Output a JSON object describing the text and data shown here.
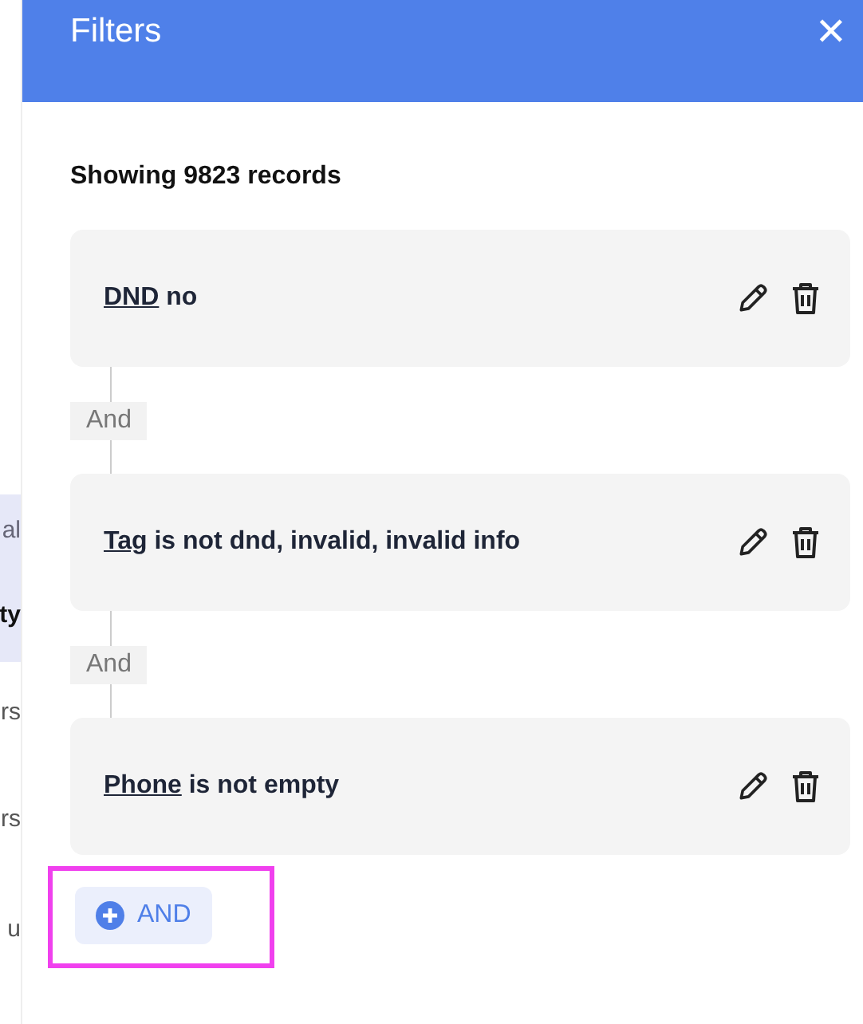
{
  "background_fragments": [
    {
      "text": "al",
      "highlighted": true
    },
    {
      "text": "ty",
      "highlighted": true
    },
    {
      "text": "rs",
      "highlighted": false
    },
    {
      "text": "rs",
      "highlighted": false
    },
    {
      "text": "u",
      "highlighted": false
    }
  ],
  "panel": {
    "title": "Filters",
    "close_icon": "✕"
  },
  "summary": "Showing 9823 records",
  "filters": [
    {
      "field": "DND",
      "condition": "no"
    },
    {
      "field": "Tag",
      "condition": "is not dnd, invalid, invalid info"
    },
    {
      "field": "Phone",
      "condition": "is not empty"
    }
  ],
  "connectors": [
    "And",
    "And"
  ],
  "add_button": {
    "label": "AND",
    "highlighted": true
  }
}
